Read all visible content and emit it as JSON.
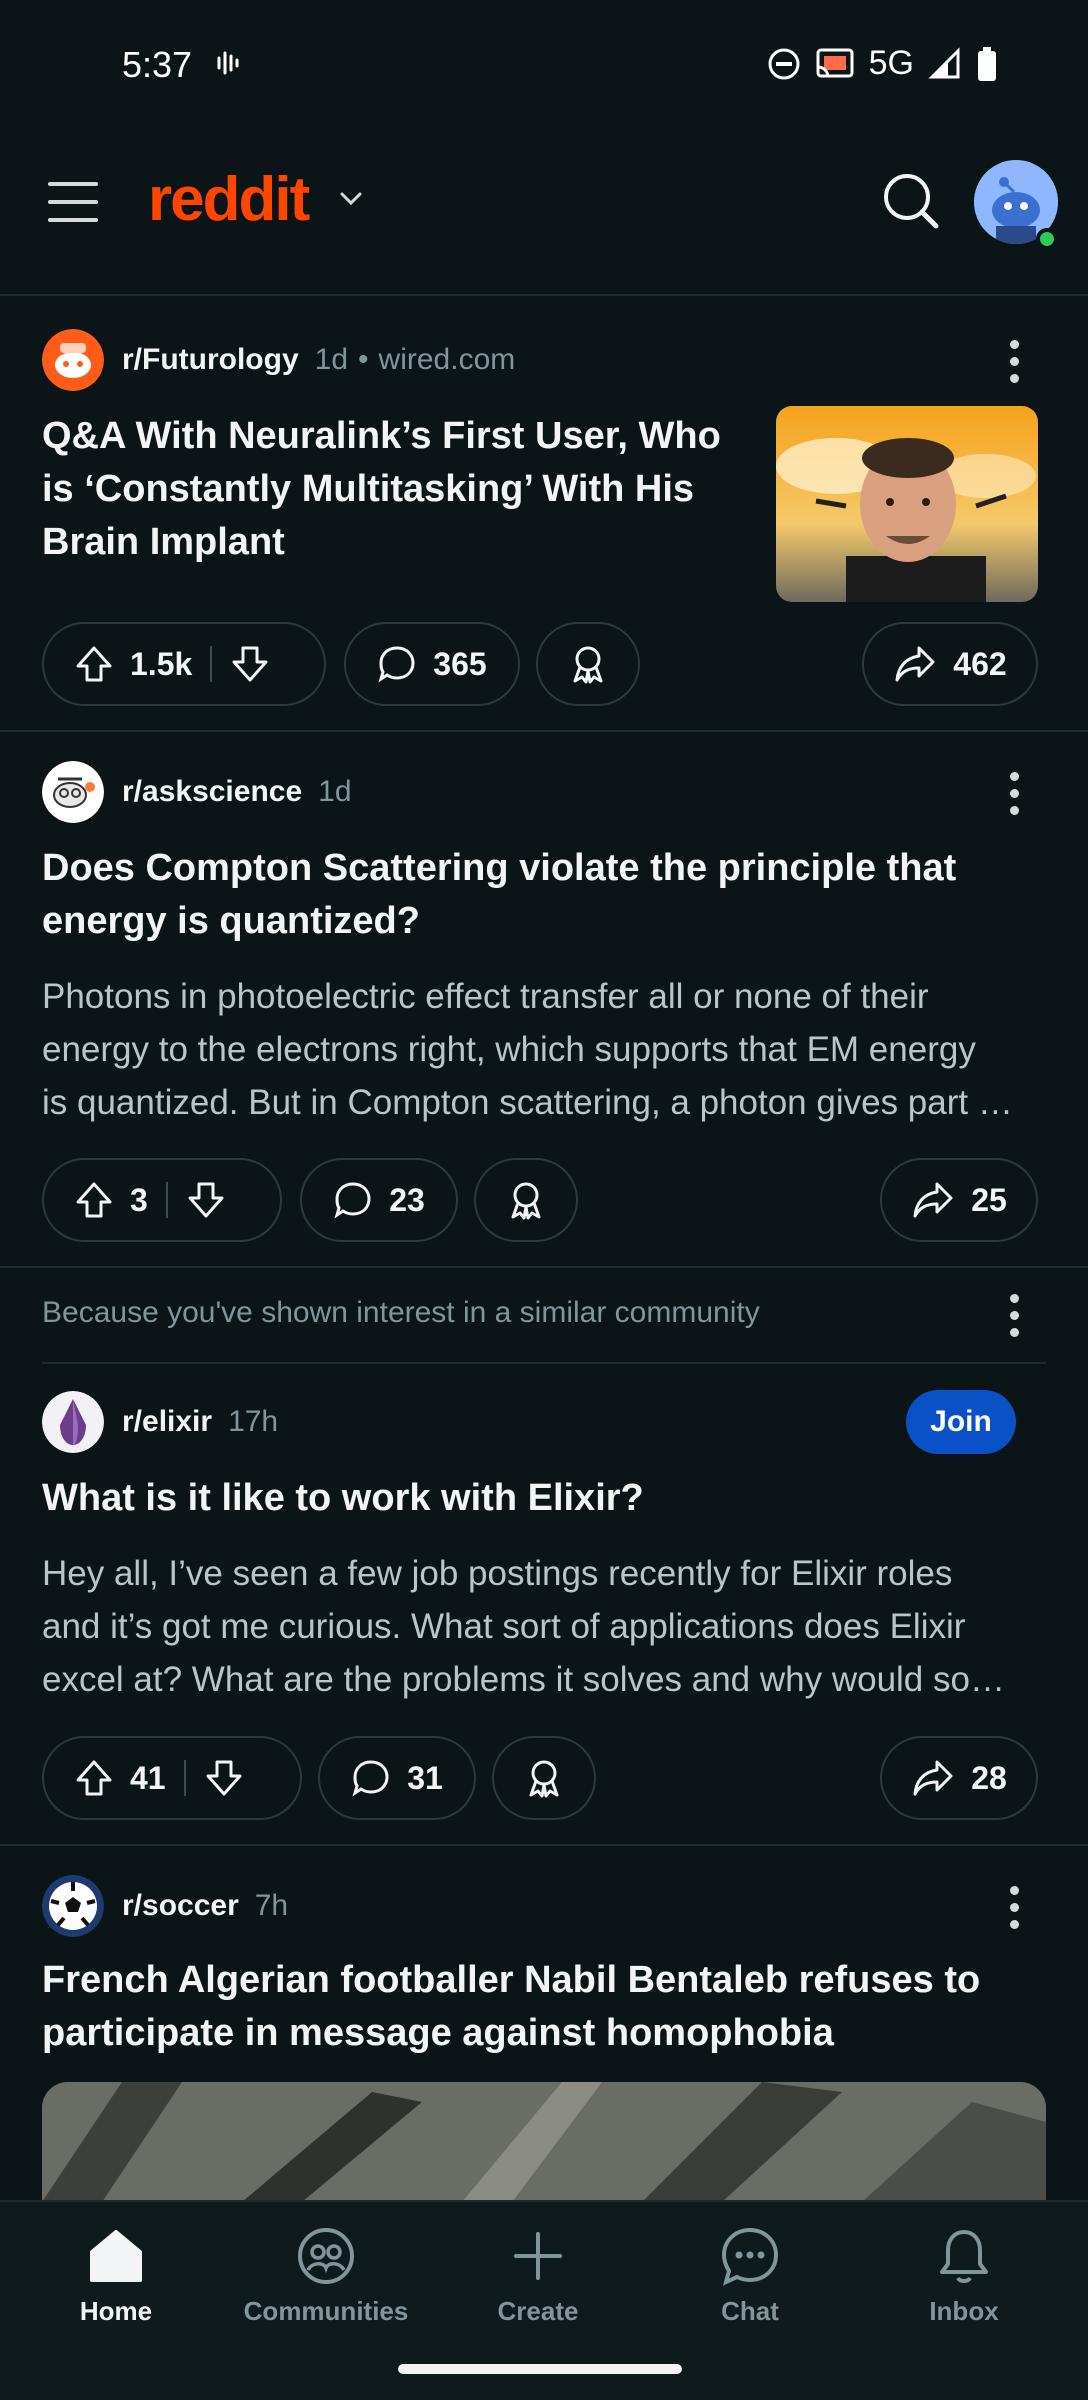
{
  "status_bar": {
    "time": "5:37",
    "network": "5G"
  },
  "header": {
    "logo": "reddit"
  },
  "posts": [
    {
      "subreddit": "r/Futurology",
      "time": "1d",
      "domain": "wired.com",
      "title_lines": [
        "Q&A With Neuralink’s First User, Who",
        "is ‘Constantly Multitasking’ With His",
        "Brain Implant"
      ],
      "upvotes": "1.5k",
      "comments": "365",
      "shares": "462"
    },
    {
      "subreddit": "r/askscience",
      "time": "1d",
      "title_lines": [
        "Does Compton Scattering violate the principle that",
        "energy is quantized?"
      ],
      "body_lines": [
        "Photons in photoelectric effect transfer all or none of their",
        "energy to the electrons right, which supports that EM energy",
        "is quantized. But in Compton scattering, a photon gives part …"
      ],
      "upvotes": "3",
      "comments": "23",
      "shares": "25"
    },
    {
      "recommendation": "Because you've shown interest in a similar community",
      "subreddit": "r/elixir",
      "time": "17h",
      "join_label": "Join",
      "title_lines": [
        "What is it like to work with Elixir?"
      ],
      "body_lines": [
        "Hey all, I’ve seen a few job postings recently for Elixir roles",
        "and it’s got me curious. What sort of applications does Elixir",
        "excel at? What are the problems it solves and why would so…"
      ],
      "upvotes": "41",
      "comments": "31",
      "shares": "28"
    },
    {
      "subreddit": "r/soccer",
      "time": "7h",
      "title_lines": [
        "French Algerian footballer Nabil Bentaleb refuses to",
        "participate in message against homophobia"
      ]
    }
  ],
  "bottom_nav": [
    {
      "label": "Home",
      "icon": "home-icon",
      "active": true
    },
    {
      "label": "Communities",
      "icon": "communities-icon"
    },
    {
      "label": "Create",
      "icon": "plus-icon"
    },
    {
      "label": "Chat",
      "icon": "chat-icon"
    },
    {
      "label": "Inbox",
      "icon": "bell-icon"
    }
  ],
  "colors": {
    "brand": "#ff4500",
    "join": "#0a51c7",
    "background": "#0b1416"
  }
}
